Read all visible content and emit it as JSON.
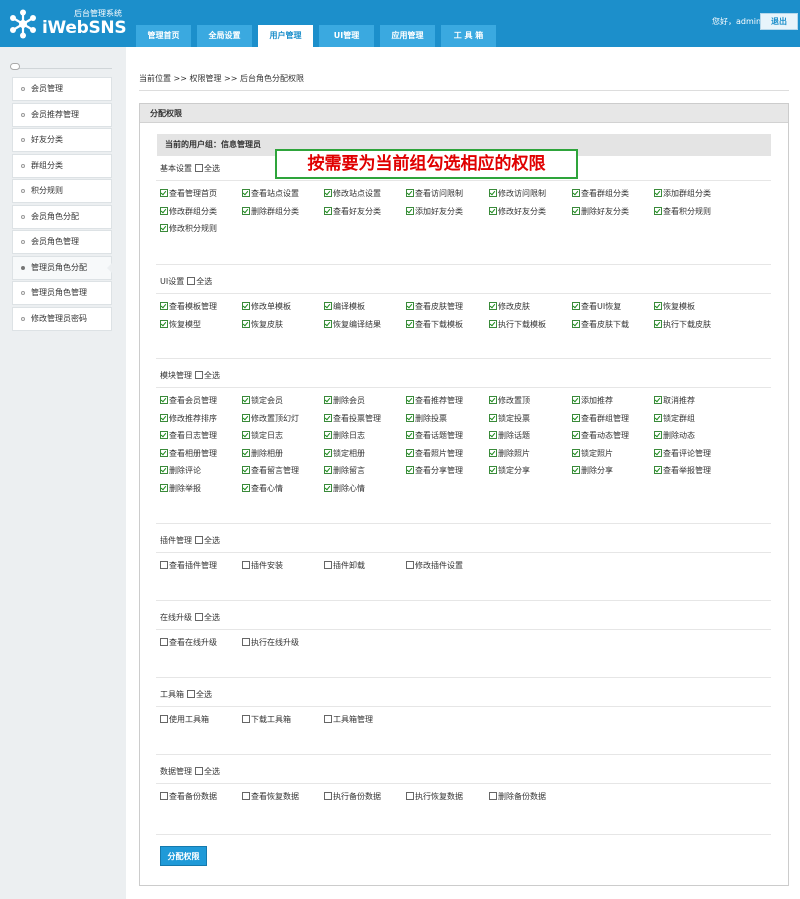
{
  "header": {
    "system_label": "后台管理系统",
    "brand": "iWebSNS",
    "greeting": "您好，admin",
    "logout_label": "退出",
    "tabs": [
      {
        "label": "管理首页",
        "active": false
      },
      {
        "label": "全局设置",
        "active": false
      },
      {
        "label": "用户管理",
        "active": true
      },
      {
        "label": "UI管理",
        "active": false
      },
      {
        "label": "应用管理",
        "active": false
      },
      {
        "label": "工 具 箱",
        "active": false
      }
    ]
  },
  "sidebar": {
    "items": [
      {
        "label": "会员管理",
        "active": false
      },
      {
        "label": "会员推荐管理",
        "active": false
      },
      {
        "label": "好友分类",
        "active": false
      },
      {
        "label": "群组分类",
        "active": false
      },
      {
        "label": "积分规则",
        "active": false
      },
      {
        "label": "会员角色分配",
        "active": false
      },
      {
        "label": "会员角色管理",
        "active": false
      },
      {
        "label": "管理员角色分配",
        "active": true
      },
      {
        "label": "管理员角色管理",
        "active": false
      },
      {
        "label": "修改管理员密码",
        "active": false
      }
    ]
  },
  "breadcrumb": "当前位置 >> 权限管理 >> 后台角色分配权限",
  "panel": {
    "title": "分配权限",
    "group_label": "当前的用户组：信息管理员",
    "annotation": "按需要为当前组勾选相应的权限",
    "select_all_label": "全选",
    "submit_label": "分配权限"
  },
  "sections": [
    {
      "title": "基本设置",
      "items": [
        {
          "label": "查看管理首页",
          "checked": true
        },
        {
          "label": "查看站点设置",
          "checked": true
        },
        {
          "label": "修改站点设置",
          "checked": true
        },
        {
          "label": "查看访问限制",
          "checked": true
        },
        {
          "label": "修改访问限制",
          "checked": true
        },
        {
          "label": "查看群组分类",
          "checked": true
        },
        {
          "label": "添加群组分类",
          "checked": true
        },
        {
          "label": "修改群组分类",
          "checked": true
        },
        {
          "label": "删除群组分类",
          "checked": true
        },
        {
          "label": "查看好友分类",
          "checked": true
        },
        {
          "label": "添加好友分类",
          "checked": true
        },
        {
          "label": "修改好友分类",
          "checked": true
        },
        {
          "label": "删除好友分类",
          "checked": true
        },
        {
          "label": "查看积分规则",
          "checked": true
        },
        {
          "label": "修改积分规则",
          "checked": true
        }
      ]
    },
    {
      "title": "UI设置",
      "items": [
        {
          "label": "查看模板管理",
          "checked": true
        },
        {
          "label": "修改单模板",
          "checked": true
        },
        {
          "label": "编译模板",
          "checked": true
        },
        {
          "label": "查看皮肤管理",
          "checked": true
        },
        {
          "label": "修改皮肤",
          "checked": true
        },
        {
          "label": "查看UI恢复",
          "checked": true
        },
        {
          "label": "恢复模板",
          "checked": true
        },
        {
          "label": "恢复模型",
          "checked": true
        },
        {
          "label": "恢复皮肤",
          "checked": true
        },
        {
          "label": "恢复编译结果",
          "checked": true
        },
        {
          "label": "查看下载模板",
          "checked": true
        },
        {
          "label": "执行下载模板",
          "checked": true
        },
        {
          "label": "查看皮肤下载",
          "checked": true
        },
        {
          "label": "执行下载皮肤",
          "checked": true
        }
      ]
    },
    {
      "title": "模块管理",
      "items": [
        {
          "label": "查看会员管理",
          "checked": true
        },
        {
          "label": "锁定会员",
          "checked": true
        },
        {
          "label": "删除会员",
          "checked": true
        },
        {
          "label": "查看推荐管理",
          "checked": true
        },
        {
          "label": "修改置顶",
          "checked": true
        },
        {
          "label": "添加推荐",
          "checked": true
        },
        {
          "label": "取消推荐",
          "checked": true
        },
        {
          "label": "修改推荐排序",
          "checked": true
        },
        {
          "label": "修改置顶幻灯",
          "checked": true
        },
        {
          "label": "查看投票管理",
          "checked": true
        },
        {
          "label": "删除投票",
          "checked": true
        },
        {
          "label": "锁定投票",
          "checked": true
        },
        {
          "label": "查看群组管理",
          "checked": true
        },
        {
          "label": "锁定群组",
          "checked": true
        },
        {
          "label": "查看日志管理",
          "checked": true
        },
        {
          "label": "锁定日志",
          "checked": true
        },
        {
          "label": "删除日志",
          "checked": true
        },
        {
          "label": "查看话题管理",
          "checked": true
        },
        {
          "label": "删除话题",
          "checked": true
        },
        {
          "label": "查看动态管理",
          "checked": true
        },
        {
          "label": "删除动态",
          "checked": true
        },
        {
          "label": "查看相册管理",
          "checked": true
        },
        {
          "label": "删除相册",
          "checked": true
        },
        {
          "label": "锁定相册",
          "checked": true
        },
        {
          "label": "查看照片管理",
          "checked": true
        },
        {
          "label": "删除照片",
          "checked": true
        },
        {
          "label": "锁定照片",
          "checked": true
        },
        {
          "label": "查看评论管理",
          "checked": true
        },
        {
          "label": "删除评论",
          "checked": true
        },
        {
          "label": "查看留言管理",
          "checked": true
        },
        {
          "label": "删除留言",
          "checked": true
        },
        {
          "label": "查看分享管理",
          "checked": true
        },
        {
          "label": "锁定分享",
          "checked": true
        },
        {
          "label": "删除分享",
          "checked": true
        },
        {
          "label": "查看举报管理",
          "checked": true
        },
        {
          "label": "删除举报",
          "checked": true
        },
        {
          "label": "查看心情",
          "checked": true
        },
        {
          "label": "删除心情",
          "checked": true
        }
      ]
    },
    {
      "title": "插件管理",
      "items": [
        {
          "label": "查看插件管理",
          "checked": false
        },
        {
          "label": "插件安装",
          "checked": false
        },
        {
          "label": "插件卸载",
          "checked": false
        },
        {
          "label": "修改插件设置",
          "checked": false
        }
      ]
    },
    {
      "title": "在线升级",
      "items": [
        {
          "label": "查看在线升级",
          "checked": false
        },
        {
          "label": "执行在线升级",
          "checked": false
        }
      ]
    },
    {
      "title": "工具箱",
      "items": [
        {
          "label": "使用工具箱",
          "checked": false
        },
        {
          "label": "下载工具箱",
          "checked": false
        },
        {
          "label": "工具箱管理",
          "checked": false
        }
      ]
    },
    {
      "title": "数据管理",
      "items": [
        {
          "label": "查看备份数据",
          "checked": false
        },
        {
          "label": "查看恢复数据",
          "checked": false
        },
        {
          "label": "执行备份数据",
          "checked": false
        },
        {
          "label": "执行恢复数据",
          "checked": false
        },
        {
          "label": "删除备份数据",
          "checked": false
        }
      ]
    }
  ]
}
